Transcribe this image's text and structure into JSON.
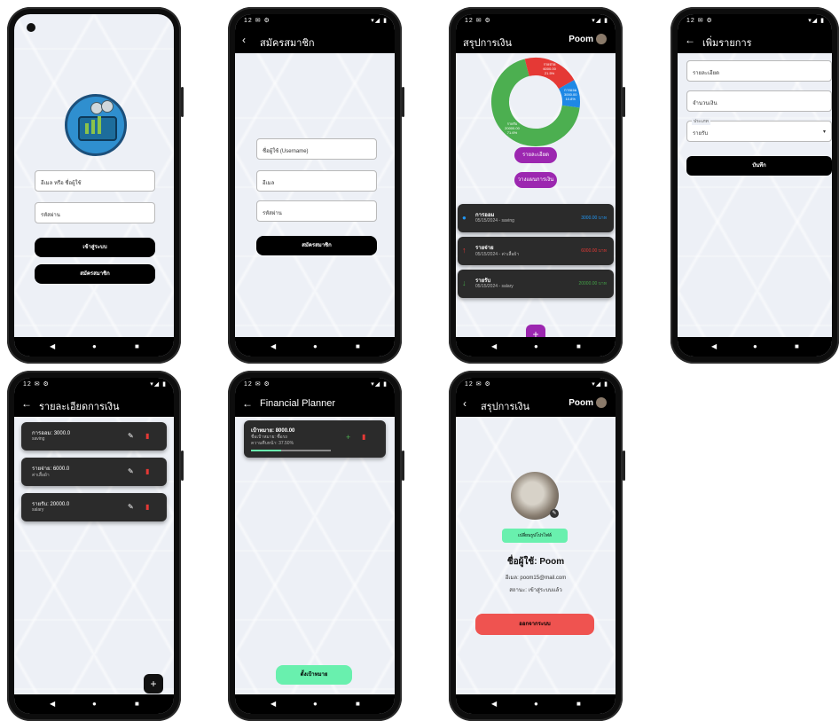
{
  "screens": {
    "login": {
      "username_placeholder": "อีเมล หรือ ชื่อผู้ใช้",
      "password_placeholder": "รหัสผ่าน",
      "login_label": "เข้าสู่ระบบ",
      "register_label": "สมัครสมาชิก"
    },
    "register": {
      "title": "สมัครสมาชิก",
      "username_placeholder": "ชื่อผู้ใช้ (Username)",
      "email_placeholder": "อีเมล",
      "password_placeholder": "รหัสผ่าน",
      "submit_label": "สมัครสมาชิก"
    },
    "summary": {
      "title": "สรุปการเงิน",
      "user_name": "Poom",
      "chart_labels": {
        "expense": "รายจ่าย\n6000.00\n21.5%",
        "saving": "การออม\n3000.00\n10.8%",
        "income": "รายรับ\n20000.00\n71.6%"
      },
      "buttons": [
        "รายละเอียด",
        "วางแผนการเงิน"
      ],
      "items": [
        {
          "title": "การออม",
          "sub": "05/15/2024 - saving",
          "amount": "3000.00 บาท",
          "color": "#2196f3",
          "icon": "piggy-bank-icon"
        },
        {
          "title": "รายจ่าย",
          "sub": "05/15/2024 - ค่าเสื้อผ้า",
          "amount": "6000.00 บาท",
          "color": "#e53935",
          "icon": "arrow-up-icon"
        },
        {
          "title": "รายรับ",
          "sub": "05/15/2024 - salary",
          "amount": "20000.00 บาท",
          "color": "#43a047",
          "icon": "arrow-down-icon"
        }
      ]
    },
    "add_entry": {
      "title": "เพิ่มรายการ",
      "detail_placeholder": "รายละเอียด",
      "amount_placeholder": "จำนวนเงิน",
      "type_label": "ประเภท",
      "type_value": "รายรับ",
      "save_label": "บันทึก"
    },
    "details": {
      "title": "รายละเอียดการเงิน",
      "items": [
        {
          "title": "การออม: 3000.0",
          "sub": "saving"
        },
        {
          "title": "รายจ่าย: 6000.0",
          "sub": "ค่าเสื้อผ้า"
        },
        {
          "title": "รายรับ: 20000.0",
          "sub": "salary"
        }
      ]
    },
    "planner": {
      "title": "Financial Planner",
      "goal_title": "เป้าหมาย: 8000.00",
      "goal_sub1": "ชื่อเป้าหมาย: ซื้อรถ",
      "goal_sub2": "ความคืบหน้า: 37.50%",
      "progress": 0.375,
      "set_goal_label": "ตั้งเป้าหมาย"
    },
    "profile": {
      "title": "สรุปการเงิน",
      "user_name": "Poom",
      "change_photo_label": "เปลี่ยนรูปโปรไฟล์",
      "username_line": "ชื่อผู้ใช้: Poom",
      "email_line": "อีเมล: poom15@mail.com",
      "status_line": "สถานะ: เข้าสู่ระบบแล้ว",
      "logout_label": "ออกจากระบบ"
    },
    "status_bar": {
      "left": "12 ✉ ⚙",
      "right": "▾◢ ▮"
    },
    "nav": {
      "back": "◀",
      "home": "●",
      "recent": "■"
    }
  },
  "chart_data": {
    "type": "pie",
    "categories": [
      "รายรับ",
      "รายจ่าย",
      "การออม"
    ],
    "values": [
      20000,
      6000,
      3000
    ],
    "colors": [
      "#4caf50",
      "#e53935",
      "#1e88e5"
    ]
  }
}
